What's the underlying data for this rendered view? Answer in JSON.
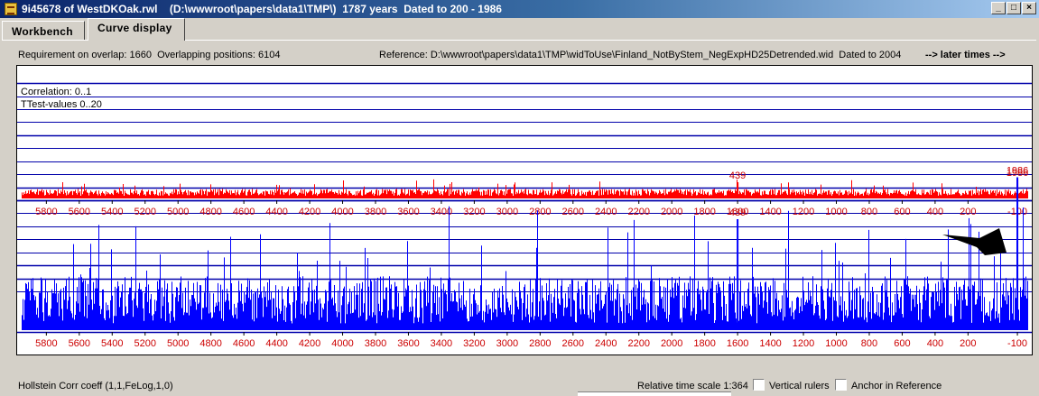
{
  "window": {
    "title": "9i45678 of WestDKOak.rwl    (D:\\wwwroot\\papers\\data1\\TMP\\)  1787 years  Dated to 200 - 1986",
    "minimize": "_",
    "maximize": "□",
    "close": "×"
  },
  "tabs": [
    {
      "label": "Workbench",
      "active": false
    },
    {
      "label": "Curve display",
      "active": true
    }
  ],
  "info": {
    "overlap": "Requirement on overlap: 1660  Overlapping positions: 6104",
    "reference": "Reference: D:\\wwwroot\\papers\\data1\\TMP\\widToUse\\Finland_NotByStem_NegExpHD25Detrended.wid  Dated to 2004",
    "later_times": "--> later times -->"
  },
  "legend": {
    "correlation": "Correlation: 0..1",
    "ttest": "TTest-values 0..20"
  },
  "colors": {
    "correlation": "#ff0000",
    "ttest": "#0000ff",
    "grid": "#0000aa",
    "axis_label": "#cc0000",
    "peak_label": "#cc0000"
  },
  "chart_data": [
    {
      "type": "bar",
      "name": "Correlation",
      "ylabel": "Correlation: 0..1",
      "ylim": [
        0,
        1
      ],
      "xlim": [
        5950,
        -160
      ],
      "x_ticks": [
        5800,
        5600,
        5400,
        5200,
        5000,
        4800,
        4600,
        4400,
        4200,
        4000,
        3800,
        3600,
        3400,
        3200,
        3000,
        2800,
        2600,
        2400,
        2200,
        2000,
        1800,
        1600,
        1400,
        1200,
        1000,
        800,
        600,
        400,
        200,
        -100
      ],
      "baseline_range": [
        0.02,
        0.07
      ],
      "peaks": [
        {
          "x": 1600,
          "y": 0.12,
          "label": "439"
        },
        {
          "x": -100,
          "y": 0.14,
          "label": "1986"
        }
      ]
    },
    {
      "type": "bar",
      "name": "TTest-values",
      "ylabel": "TTest-values 0..20",
      "ylim": [
        0,
        20
      ],
      "xlim": [
        5950,
        -160
      ],
      "x_ticks": [
        5800,
        5600,
        5400,
        5200,
        5000,
        4800,
        4600,
        4400,
        4200,
        4000,
        3800,
        3600,
        3400,
        3200,
        3000,
        2800,
        2600,
        2400,
        2200,
        2000,
        1800,
        1600,
        1400,
        1200,
        1000,
        800,
        600,
        400,
        200,
        -100
      ],
      "baseline_range": [
        0.5,
        4
      ],
      "peaks": [
        {
          "x": 1600,
          "y": 8.2,
          "label": "439"
        },
        {
          "x": -100,
          "y": 11.3,
          "label": "1986"
        }
      ]
    }
  ],
  "status": {
    "left": "Hollstein Corr coeff (1,1,FeLog,1,0)",
    "time_scale": "Relative time scale 1:364",
    "vertical_rulers": "Vertical rulers",
    "anchor": "Anchor in Reference"
  }
}
